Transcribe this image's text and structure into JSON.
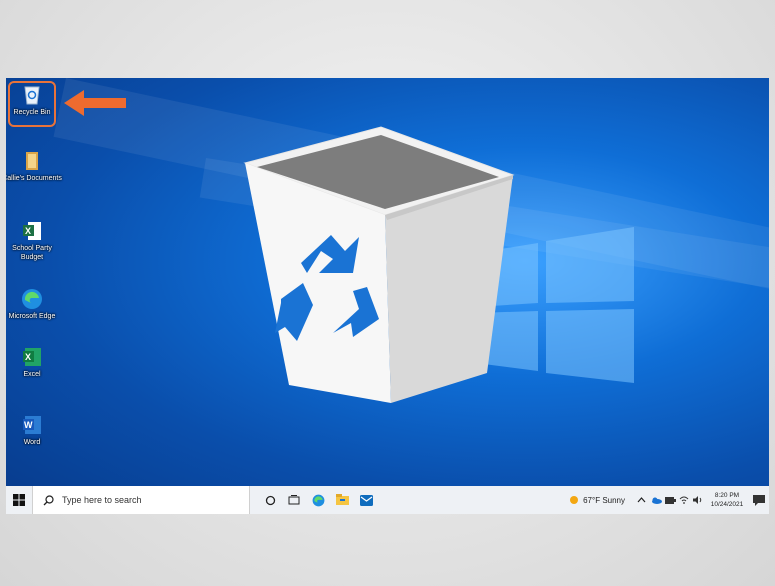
{
  "desktop": {
    "icons": [
      {
        "label": "Recycle Bin",
        "icon": "recycle-bin-icon"
      },
      {
        "label": "Callie's Documents",
        "icon": "folder-icon"
      },
      {
        "label": "School Party Budget",
        "icon": "excel-file-icon"
      },
      {
        "label": "Microsoft Edge",
        "icon": "edge-icon"
      },
      {
        "label": "Excel",
        "icon": "excel-icon"
      },
      {
        "label": "Word",
        "icon": "word-icon"
      }
    ],
    "highlight_color": "#e8733a",
    "wallpaper_accent": "#0f6ed6"
  },
  "taskbar": {
    "search_placeholder": "Type here to search",
    "weather": "67°F Sunny",
    "time": "8:20 PM",
    "date": "10/24/2021"
  }
}
